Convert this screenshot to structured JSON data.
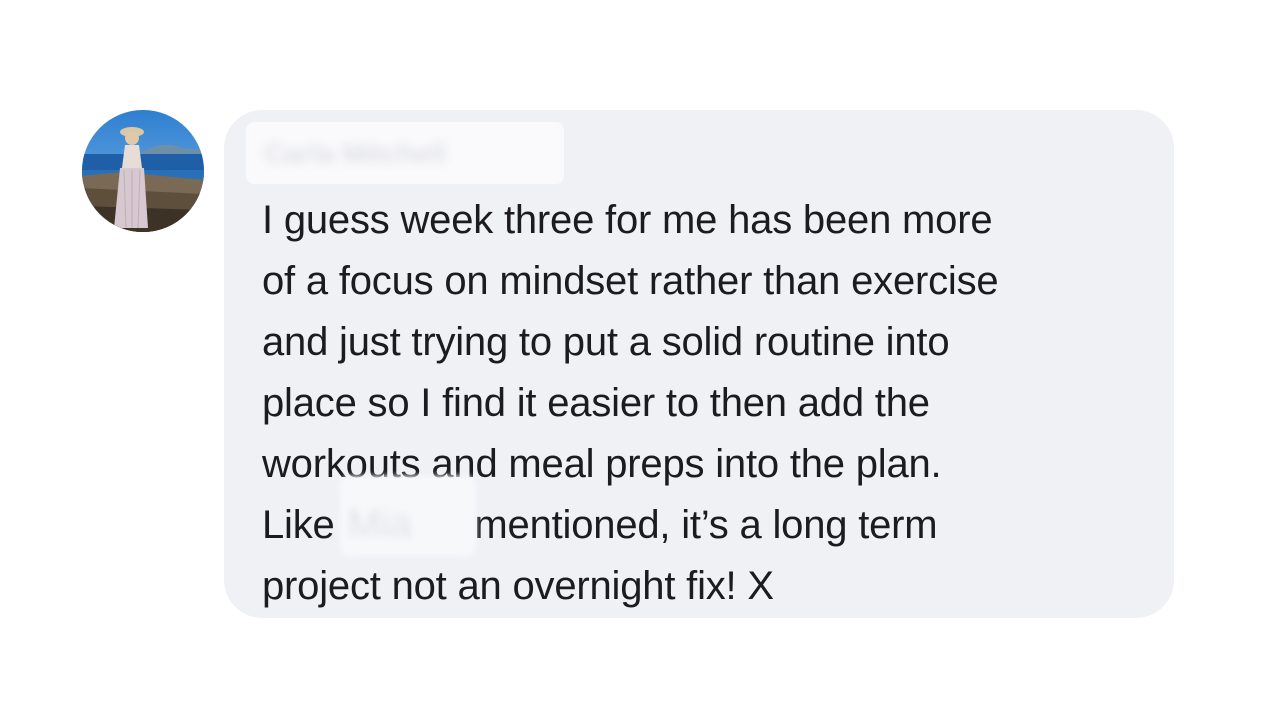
{
  "comment": {
    "author": {
      "name": "Carla Mitchell",
      "avatar_icon": "profile-photo-avatar"
    },
    "mentioned_name": "Mia",
    "lines": {
      "l1": "I guess week three for me has been more",
      "l2": "of a focus on mindset rather than exercise",
      "l3": "and just trying to put a solid routine into",
      "l4": "place so I find it easier to then add the",
      "l5": "workouts and meal preps into the plan.",
      "l6_before": "Like ",
      "l6_after": " mentioned, it’s a long term",
      "l7": "project not an overnight fix! X"
    },
    "colors": {
      "bubble": "#f0f1f5",
      "text": "#1c1c1e"
    }
  }
}
